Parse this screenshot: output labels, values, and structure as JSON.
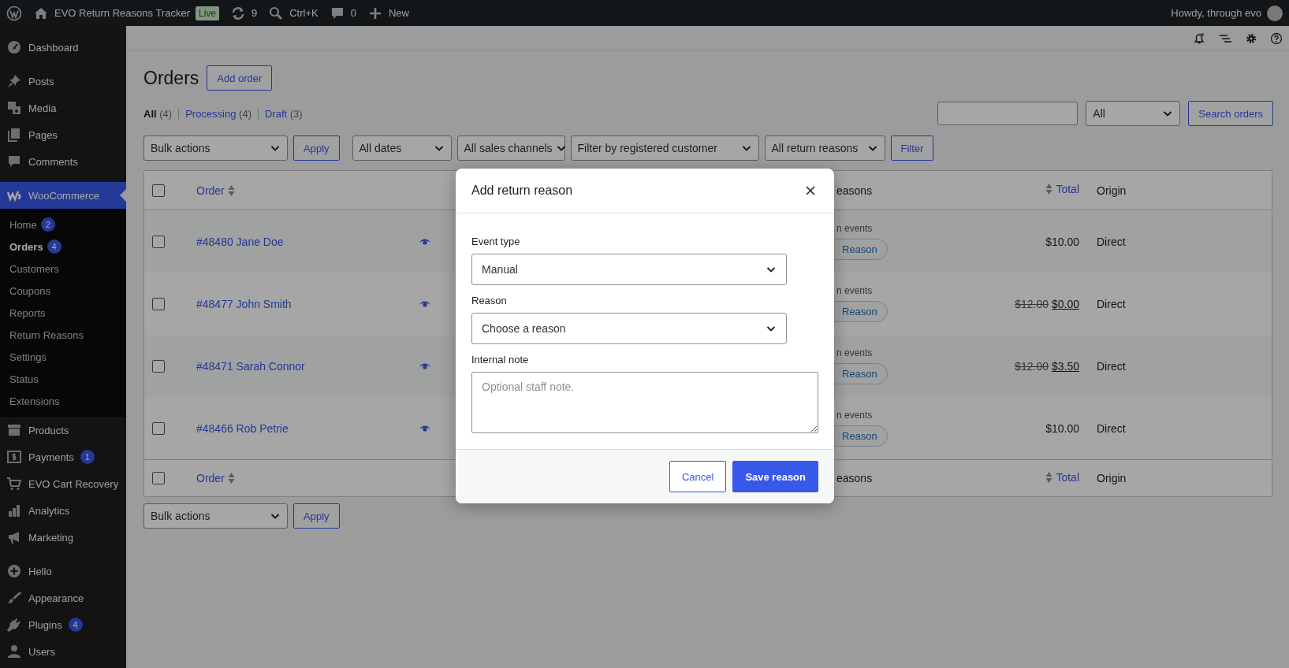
{
  "admin_bar": {
    "items": [
      {
        "kind": "logo"
      },
      {
        "kind": "site",
        "label": "EVO Return Reasons Tracker",
        "badge": "Live"
      },
      {
        "kind": "updates",
        "label": "9"
      },
      {
        "kind": "search",
        "label": "Ctrl+K"
      },
      {
        "kind": "comments",
        "label": "0"
      },
      {
        "kind": "new",
        "label": "New"
      }
    ],
    "greeting": "Howdy, through evo"
  },
  "sidebar": {
    "groups": [
      [
        {
          "label": "Dashboard",
          "selected": false
        }
      ],
      [
        {
          "label": "Posts",
          "selected": false
        },
        {
          "label": "Media",
          "selected": false
        },
        {
          "label": "Pages",
          "selected": false
        },
        {
          "label": "Comments",
          "selected": false
        }
      ],
      [
        {
          "label": "WooCommerce",
          "selected": true,
          "children": [
            {
              "label": "Home",
              "badge": "2",
              "selected": false
            },
            {
              "label": "Orders",
              "badge": "4",
              "selected": true
            },
            {
              "label": "Customers",
              "selected": false
            },
            {
              "label": "Coupons",
              "selected": false
            },
            {
              "label": "Reports",
              "selected": false
            },
            {
              "label": "Return Reasons",
              "selected": false
            },
            {
              "label": "Settings",
              "selected": false
            },
            {
              "label": "Status",
              "selected": false
            },
            {
              "label": "Extensions",
              "selected": false
            }
          ]
        },
        {
          "label": "Products",
          "selected": false
        },
        {
          "label": "Payments",
          "badge": "1",
          "selected": false
        },
        {
          "label": "EVO Cart Recovery",
          "selected": false
        },
        {
          "label": "Analytics",
          "selected": false
        },
        {
          "label": "Marketing",
          "selected": false
        }
      ],
      [
        {
          "label": "Hello",
          "selected": false
        },
        {
          "label": "Appearance",
          "selected": false
        },
        {
          "label": "Plugins",
          "badge": "4",
          "selected": false
        },
        {
          "label": "Users",
          "selected": false
        }
      ]
    ]
  },
  "page": {
    "title": "Orders",
    "add_button": "Add order",
    "views": [
      {
        "label": "All",
        "count": "(4)",
        "selected": true
      },
      {
        "label": "Processing",
        "count": "(4)",
        "selected": false
      },
      {
        "label": "Draft",
        "count": "(3)",
        "selected": false
      }
    ],
    "search": {
      "status_select": "All",
      "button": "Search orders"
    },
    "filters": {
      "bulk_select": "Bulk actions",
      "apply": "Apply",
      "selects": [
        "All dates",
        "All sales channels",
        "Filter by registered customer",
        "All return reasons"
      ],
      "button": "Filter"
    },
    "table": {
      "header": {
        "checked": false,
        "order": "Order",
        "reasons": "easons",
        "total": "Total",
        "origin": "Origin"
      },
      "rows": [
        {
          "checked": false,
          "order": "#48480 Jane Doe",
          "events": "n events",
          "reason_button": "Reason",
          "total": "$10.00",
          "origin": "Direct"
        },
        {
          "checked": false,
          "order": "#48477 John Smith",
          "events": "n events",
          "reason_button": "Reason",
          "was": "$12.00",
          "total": "$0.00",
          "origin": "Direct"
        },
        {
          "checked": false,
          "order": "#48471 Sarah Connor",
          "events": "n events",
          "reason_button": "Reason",
          "was": "$12.00",
          "total": "$3.50",
          "origin": "Direct"
        },
        {
          "checked": false,
          "order": "#48466 Rob Petrie",
          "events": "n events",
          "reason_button": "Reason",
          "total": "$10.00",
          "origin": "Direct"
        }
      ],
      "footer": {
        "checked": false,
        "order": "Order",
        "reasons": "easons",
        "total": "Total",
        "origin": "Origin"
      }
    },
    "bottom_bulk": {
      "bulk_select": "Bulk actions",
      "apply": "Apply"
    }
  },
  "modal": {
    "title": "Add return reason",
    "fields": [
      {
        "kind": "select",
        "label": "Event type",
        "value": "Manual"
      },
      {
        "kind": "select",
        "label": "Reason",
        "value": "Choose a reason"
      },
      {
        "kind": "textarea",
        "label": "Internal note",
        "placeholder": "Optional staff note."
      }
    ],
    "buttons": [
      {
        "kind": "secondary",
        "label": "Cancel"
      },
      {
        "kind": "primary",
        "label": "Save reason"
      }
    ]
  }
}
